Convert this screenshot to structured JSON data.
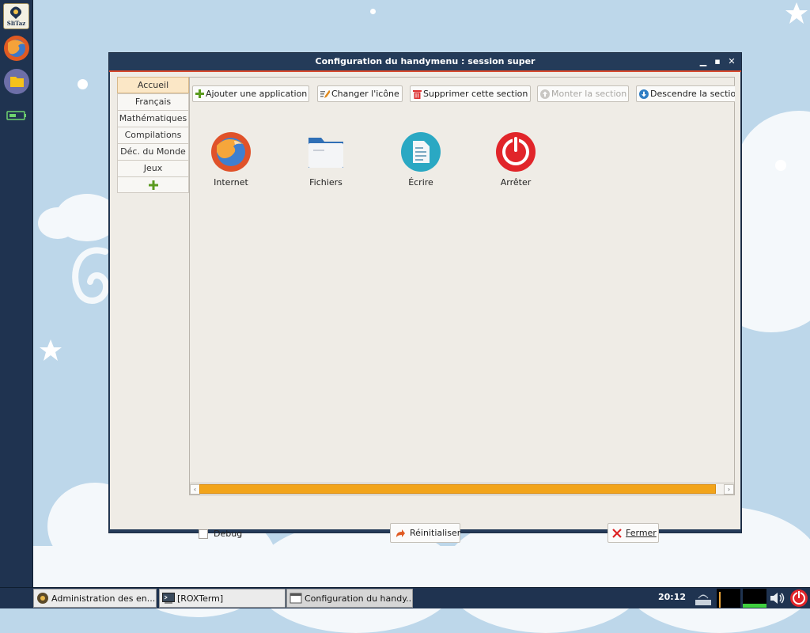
{
  "window": {
    "title": "Configuration du handymenu : session super",
    "accent_color": "#d84a2e",
    "title_color": "#243b59"
  },
  "launcher": {
    "logo_text": "SliTaz",
    "items": [
      {
        "icon": "slitaz-logo-icon"
      },
      {
        "icon": "firefox-icon"
      },
      {
        "icon": "folder-icon"
      },
      {
        "icon": "battery-icon"
      }
    ]
  },
  "tabs": [
    {
      "label": "Accueil",
      "active": true
    },
    {
      "label": "Français"
    },
    {
      "label": "Mathématiques"
    },
    {
      "label": "Compilations"
    },
    {
      "label": "Déc. du Monde"
    },
    {
      "label": "Jeux"
    },
    {
      "label": "+",
      "icon": "plus-icon"
    }
  ],
  "toolbar": {
    "add_app": "Ajouter une application",
    "change_icon": "Changer l'icône",
    "delete_section": "Supprimer cette section",
    "move_up": "Monter la section",
    "move_down": "Descendre la section"
  },
  "apps": [
    {
      "label": "Internet",
      "icon": "firefox-icon"
    },
    {
      "label": "Fichiers",
      "icon": "folder-icon"
    },
    {
      "label": "Écrire",
      "icon": "document-icon"
    },
    {
      "label": "Arrêter",
      "icon": "power-icon"
    }
  ],
  "bottom": {
    "debug_label": "Debug",
    "debug_checked": false,
    "reset_label": "Réinitialiser",
    "close_label": "Fermer"
  },
  "taskbar": {
    "tasks": [
      {
        "label": "Administration des en...",
        "icon": "admin-icon"
      },
      {
        "label": "[ROXTerm]",
        "icon": "terminal-icon"
      },
      {
        "label": "Configuration du handy...",
        "icon": "window-icon"
      }
    ],
    "clock": "20:12"
  },
  "colors": {
    "scrollbar_thumb": "#f2a41a",
    "active_tab": "#fbe7c6",
    "panel_bg": "#efece6",
    "taskbar": "#1f3350"
  }
}
